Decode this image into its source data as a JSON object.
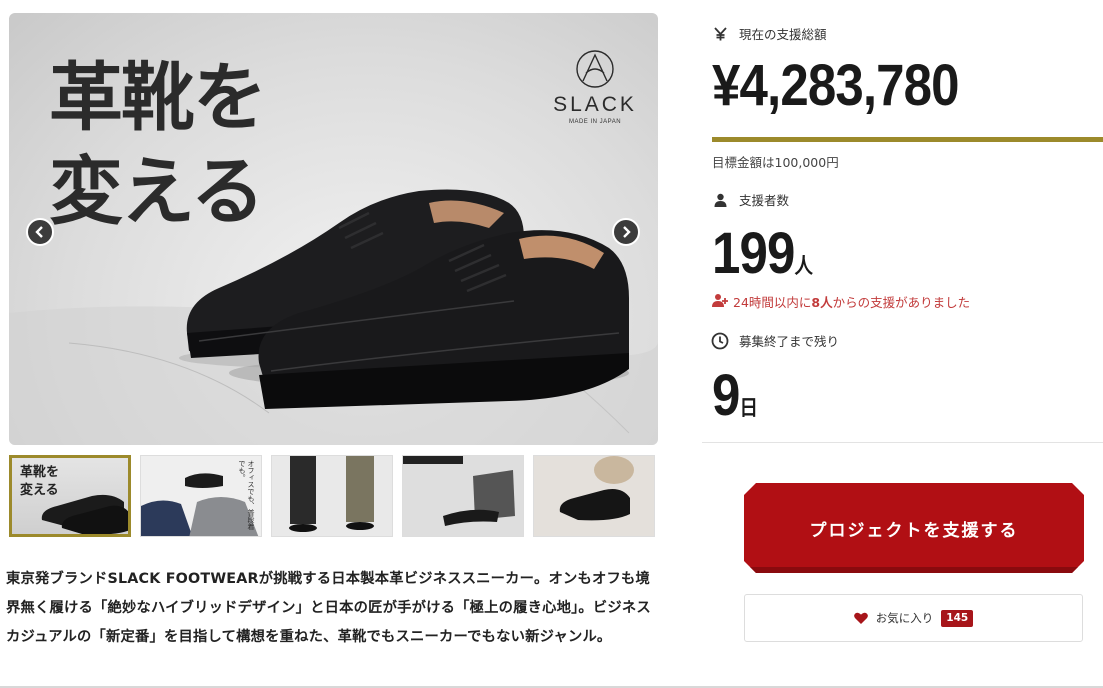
{
  "gallery": {
    "hero": {
      "headline_line1": "革靴を",
      "headline_line2": "変える",
      "brand_name": "SLACK",
      "brand_sub": "MADE IN JAPAN"
    },
    "thumbnails": [
      {
        "label_line1": "革靴を",
        "label_line2": "変える",
        "active": true
      },
      {
        "caption": "オフィスでも、普段着でも。",
        "active": false
      },
      {
        "active": false
      },
      {
        "active": false
      },
      {
        "active": false
      }
    ]
  },
  "description": "東京発ブランドSLACK FOOTWEARが挑戦する日本製本革ビジネススニーカー。オンもオフも境界無く履ける「絶妙なハイブリッドデザイン」と日本の匠が手がける「極上の履き心地」。ビジネスカジュアルの「新定番」を目指して構想を重ねた、革靴でもスニーカーでもない新ジャンル。",
  "stats": {
    "total": {
      "icon": "yen-icon",
      "label": "現在の支援総額",
      "amount": "¥4,283,780"
    },
    "progress": {
      "percent": 100,
      "color": "#9c8a2b"
    },
    "goal": "目標金額は100,000円",
    "backers": {
      "icon": "person-icon",
      "label": "支援者数",
      "count": "199",
      "unit": "人"
    },
    "recent": {
      "icon": "person-plus-icon",
      "prefix": "24時間以内に",
      "count": "8人",
      "suffix": "からの支援がありました",
      "color": "#c23b3b"
    },
    "remaining": {
      "icon": "clock-icon",
      "label": "募集終了まで残り",
      "count": "9",
      "unit": "日"
    }
  },
  "actions": {
    "support_button": "プロジェクトを支援する",
    "support_color": "#b10f14",
    "favorite_label": "お気に入り",
    "favorite_count": "145",
    "favorite_icon": "heart-icon"
  }
}
